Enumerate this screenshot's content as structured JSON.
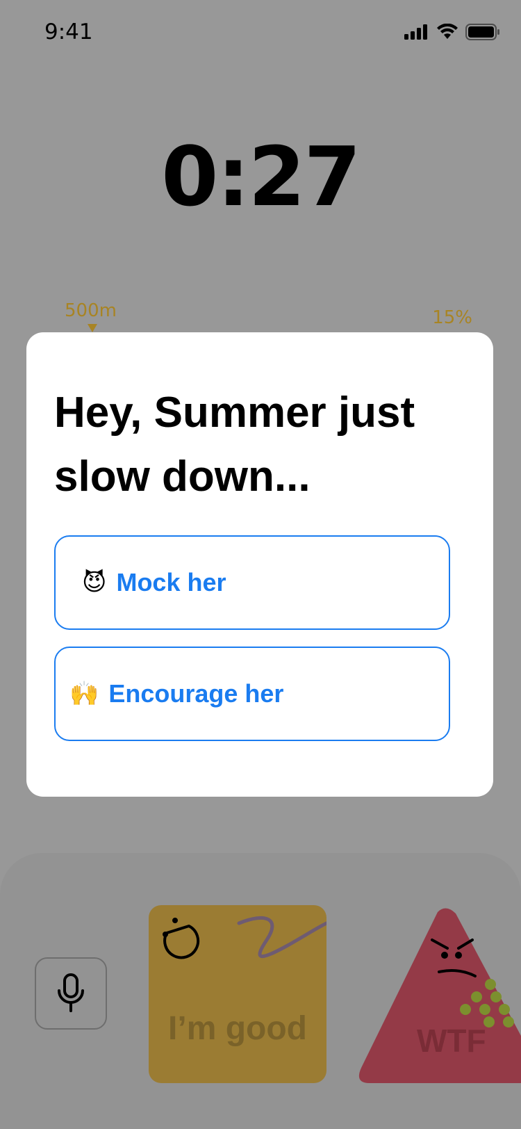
{
  "status_bar": {
    "time": "9:41",
    "icons": [
      "signal-icon",
      "wifi-icon",
      "battery-icon"
    ]
  },
  "timer": {
    "value": "0:27"
  },
  "progress": {
    "marker_label": "500m",
    "percent_label": "15%"
  },
  "modal": {
    "title": "Hey, Summer just slow down...",
    "options": [
      {
        "emoji": "😈",
        "label": "Mock her"
      },
      {
        "emoji": "🙌",
        "label": "Encourage her"
      }
    ]
  },
  "tray": {
    "mic_icon": "microphone-icon",
    "cards": [
      {
        "label": "I’m good",
        "color": "#9b7c33"
      },
      {
        "label": "WTF",
        "color": "#943a47"
      }
    ]
  },
  "colors": {
    "background": "#989898",
    "accent": "#1a7cf0",
    "marker": "#a88424"
  }
}
